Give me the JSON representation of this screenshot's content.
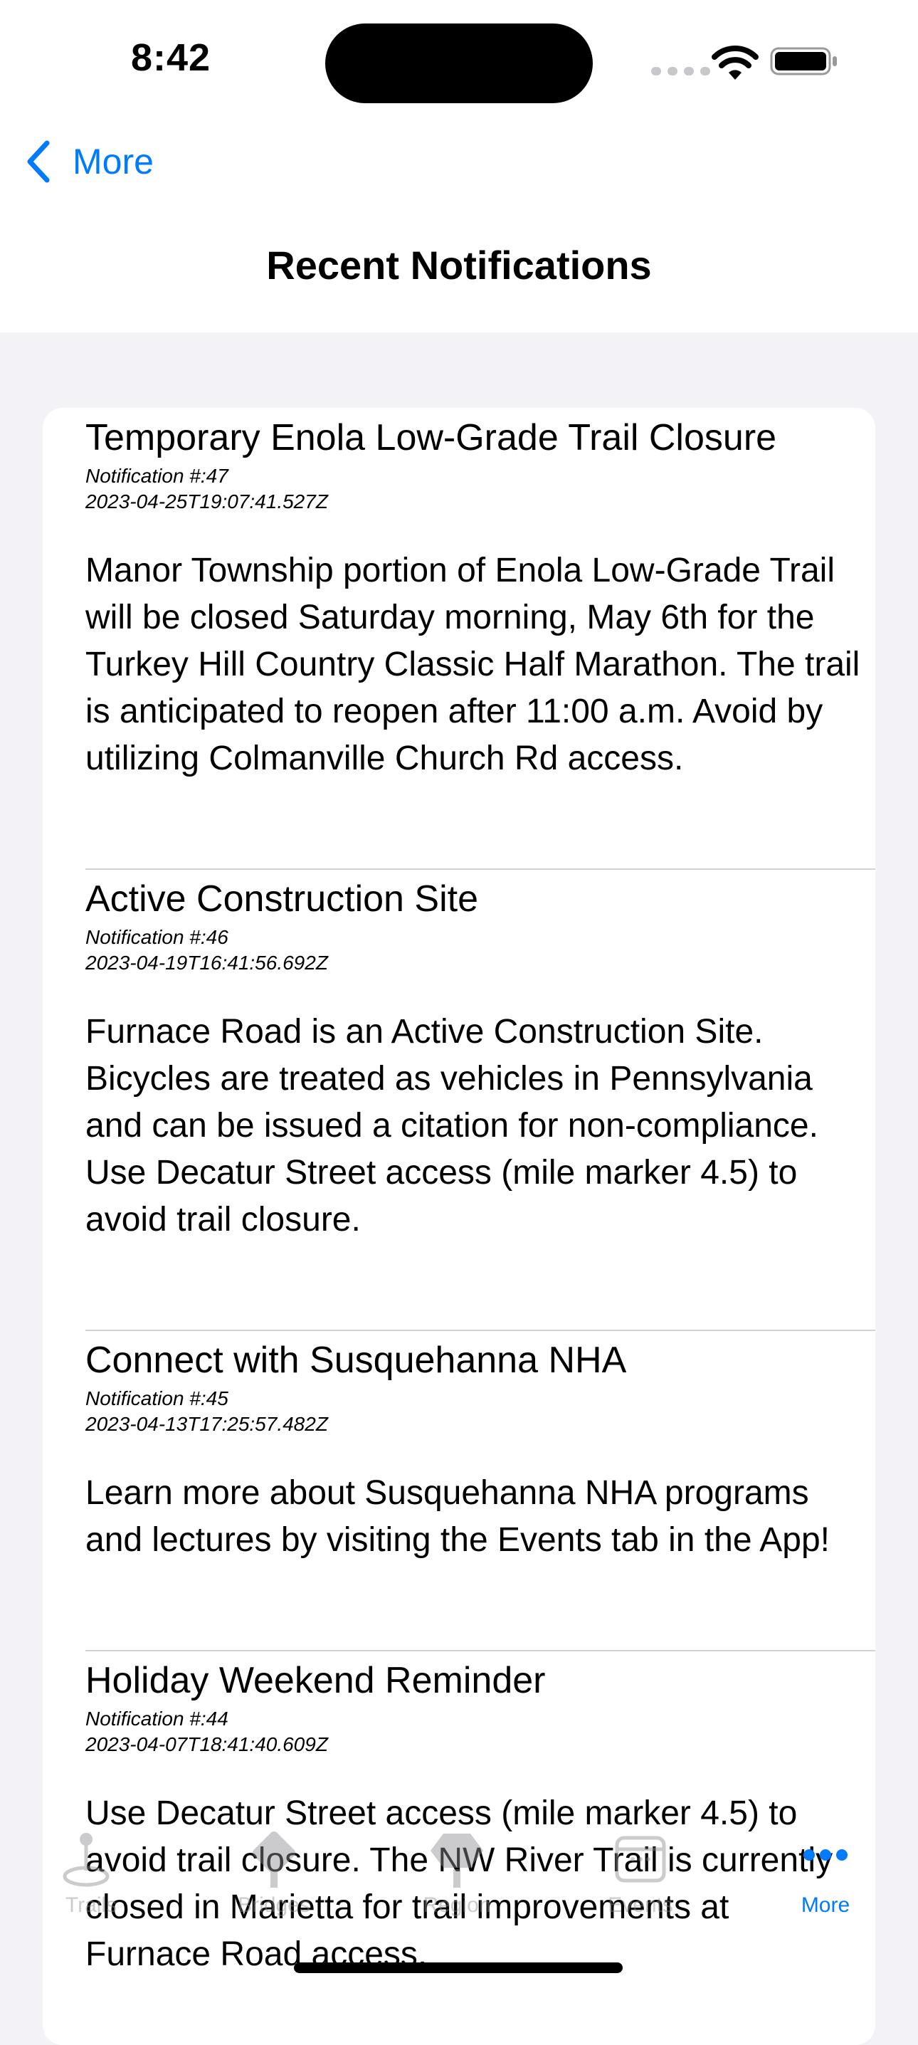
{
  "status_bar": {
    "time": "8:42"
  },
  "nav": {
    "back_label": "More",
    "title": "Recent Notifications"
  },
  "notifications": [
    {
      "title": "Temporary Enola Low-Grade Trail Closure",
      "number": "Notification #:47",
      "date": "2023-04-25T19:07:41.527Z",
      "body": "Manor Township portion of Enola Low-Grade Trail will be closed Saturday morning, May 6th for the Turkey Hill Country Classic Half Marathon. The trail is anticipated to reopen after 11:00 a.m. Avoid by utilizing Colmanville Church Rd access."
    },
    {
      "title": "Active Construction Site",
      "number": "Notification #:46",
      "date": "2023-04-19T16:41:56.692Z",
      "body": "Furnace Road is an Active Construction Site. Bicycles are treated as vehicles in Pennsylvania and can be issued a citation for non-compliance. Use Decatur Street access (mile marker 4.5) to avoid trail closure."
    },
    {
      "title": "Connect with Susquehanna NHA",
      "number": "Notification #:45",
      "date": "2023-04-13T17:25:57.482Z",
      "body": "Learn more about Susquehanna NHA programs and lectures by visiting the Events tab in the App!"
    },
    {
      "title": "Holiday Weekend Reminder",
      "number": "Notification #:44",
      "date": "2023-04-07T18:41:40.609Z",
      "body": "Use Decatur Street access (mile marker 4.5) to avoid trail closure. The NW River Trail is currently closed in Marietta for trail improvements at Furnace Road access."
    }
  ],
  "tabbar": {
    "tabs": [
      {
        "label": "Trails",
        "icon": "map-pin-icon",
        "active": false
      },
      {
        "label": "Bridges",
        "icon": "road-sign-icon",
        "active": false
      },
      {
        "label": "Region",
        "icon": "marker-icon",
        "active": false
      },
      {
        "label": "Events",
        "icon": "calendar-icon",
        "active": false
      },
      {
        "label": "More",
        "icon": "more-dots-icon",
        "active": true
      }
    ]
  },
  "colors": {
    "accent": "#007aff",
    "background": "#f2f2f7",
    "card": "#ffffff"
  }
}
